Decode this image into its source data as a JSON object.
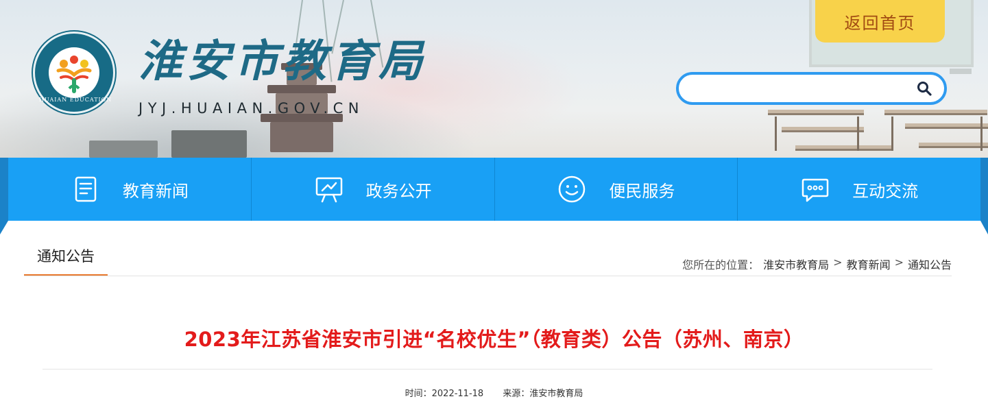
{
  "header": {
    "site_title": "淮安市教育局",
    "site_domain": "JYJ.HUAIAN.GOV.CN",
    "logo_ring_text": "HUAIAN EDUCATION",
    "home_button": "返回首页",
    "search": {
      "value": "",
      "placeholder": ""
    }
  },
  "nav": {
    "items": [
      {
        "label": "教育新闻",
        "icon": "news-document-icon"
      },
      {
        "label": "政务公开",
        "icon": "presentation-board-icon"
      },
      {
        "label": "便民服务",
        "icon": "smiley-face-icon"
      },
      {
        "label": "互动交流",
        "icon": "chat-bubble-icon"
      }
    ]
  },
  "content": {
    "section_tab": "通知公告",
    "breadcrumb": {
      "prefix": "您所在的位置：",
      "items": [
        "淮安市教育局",
        "教育新闻",
        "通知公告"
      ],
      "separator": ">"
    },
    "article": {
      "title": "2023年江苏省淮安市引进“名校优生”（教育类）公告（苏州、南京）",
      "time_label": "时间：",
      "date": "2022-11-18",
      "source_label": "来源：",
      "source": "淮安市教育局"
    }
  },
  "colors": {
    "nav_blue": "#19a0f5",
    "home_button_yellow": "#f8d24a",
    "title_red": "#e31b1b",
    "tab_underline_orange": "#e8792e",
    "logo_teal": "#176b86"
  }
}
